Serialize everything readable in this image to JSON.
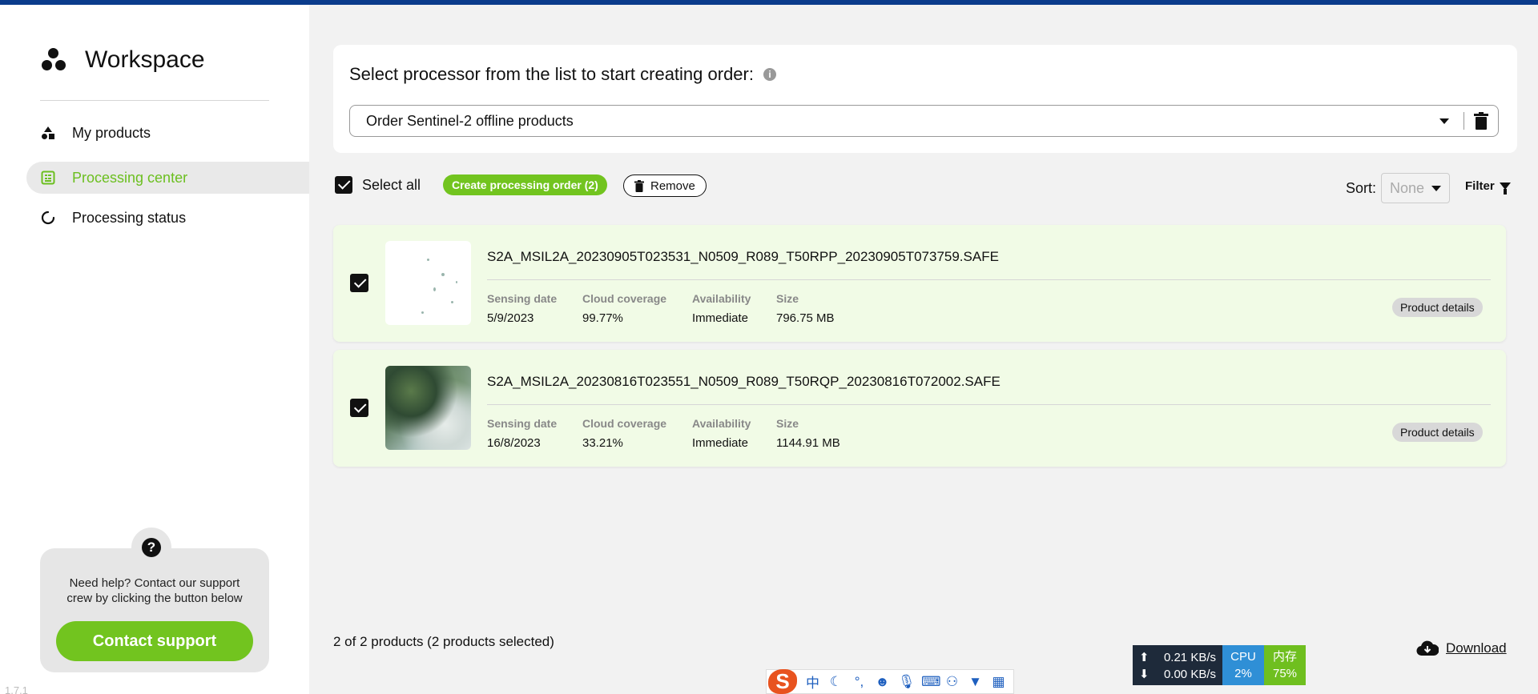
{
  "app": {
    "title": "Workspace",
    "version": "1.7.1",
    "accent_color": "#72c41f",
    "topbar_color": "#0b3c8c"
  },
  "sidebar": {
    "items": [
      {
        "label": "My products",
        "icon": "shapes-icon",
        "active": false
      },
      {
        "label": "Processing center",
        "icon": "processing-center-icon",
        "active": true
      },
      {
        "label": "Processing status",
        "icon": "status-spinner-icon",
        "active": false
      }
    ],
    "help": {
      "text": "Need help? Contact our support crew by clicking the button below",
      "button_label": "Contact support",
      "icon": "question-icon"
    }
  },
  "processor": {
    "title": "Select processor from the list to start creating order:",
    "selected": "Order Sentinel-2 offline products"
  },
  "toolbar": {
    "select_all_label": "Select all",
    "select_all_checked": true,
    "create_label": "Create processing order (2)",
    "remove_label": "Remove",
    "sort_label": "Sort:",
    "sort_value": "None",
    "filter_label": "Filter"
  },
  "meta_labels": {
    "sensing_date": "Sensing date",
    "cloud_coverage": "Cloud coverage",
    "availability": "Availability",
    "size": "Size"
  },
  "products": [
    {
      "name": "S2A_MSIL2A_20230905T023531_N0509_R089_T50RPP_20230905T073759.SAFE",
      "sensing_date": "5/9/2023",
      "cloud_coverage": "99.77%",
      "availability": "Immediate",
      "size": "796.75 MB",
      "checked": true,
      "details_label": "Product details"
    },
    {
      "name": "S2A_MSIL2A_20230816T023551_N0509_R089_T50RQP_20230816T072002.SAFE",
      "sensing_date": "16/8/2023",
      "cloud_coverage": "33.21%",
      "availability": "Immediate",
      "size": "1144.91 MB",
      "checked": true,
      "details_label": "Product details"
    }
  ],
  "footer": {
    "count_text": "2 of 2 products (2 products selected)",
    "download_label": "Download"
  },
  "system_tray": {
    "upload": "0.21 KB/s",
    "download": "0.00 KB/s",
    "cpu_label": "CPU",
    "cpu_value": "2%",
    "mem_label": "内存",
    "mem_value": "75%",
    "ime_logo": "S",
    "ime_mode": "中"
  }
}
